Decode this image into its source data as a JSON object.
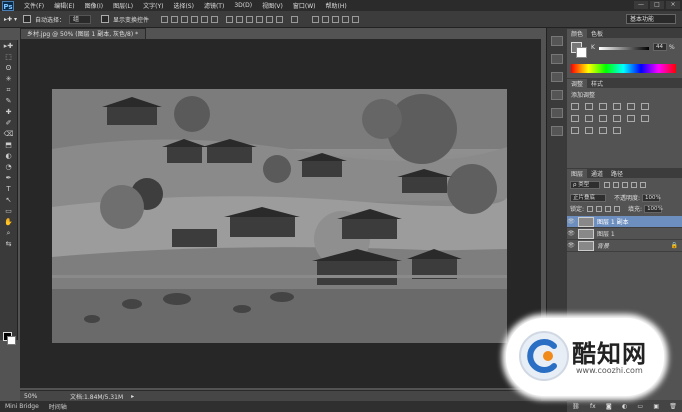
{
  "app": {
    "logo": "Ps"
  },
  "menu": [
    "文件(F)",
    "编辑(E)",
    "图像(I)",
    "图层(L)",
    "文字(Y)",
    "选择(S)",
    "滤镜(T)",
    "3D(D)",
    "视图(V)",
    "窗口(W)",
    "帮助(H)"
  ],
  "window_controls": [
    "—",
    "□",
    "×"
  ],
  "options": {
    "auto_select_label": "自动选择：",
    "auto_select_value": "组",
    "show_transform_label": "显示变换控件",
    "workspace": "基本功能"
  },
  "document": {
    "tab_title": "乡村.jpg @ 50% (图层 1 副本, 灰色/8) *",
    "tab_close": "×",
    "zoom": "50%",
    "doc_info": "文档:1.84M/5.31M"
  },
  "bottom_tabs": [
    "Mini Bridge",
    "时间轴"
  ],
  "tools": [
    "▸✚",
    "⬚",
    "ʘ",
    "✳",
    "⌗",
    "✎",
    "✚",
    "✐",
    "⌫",
    "⬒",
    "◐",
    "◔",
    "✒",
    "T",
    "↖",
    "▭",
    "✋",
    "⌕",
    "⇆"
  ],
  "color_panel": {
    "tabs": [
      "颜色",
      "色板"
    ],
    "value_label": "K",
    "value": "44",
    "unit": "%"
  },
  "adjustments_panel": {
    "tabs": [
      "调整",
      "样式"
    ],
    "title": "添加调整"
  },
  "layers_panel": {
    "tabs": [
      "图层",
      "通道",
      "路径"
    ],
    "filter_label": "ρ 类型",
    "blend_mode": "正片叠底",
    "opacity_label": "不透明度:",
    "opacity": "100%",
    "lock_label": "锁定:",
    "fill_label": "填充:",
    "fill": "100%",
    "layers": [
      {
        "name": "图层 1 副本",
        "selected": true
      },
      {
        "name": "图层 1",
        "selected": false
      },
      {
        "name": "背景",
        "selected": false
      }
    ]
  },
  "watermark": {
    "title": "酷知网",
    "url": "www.coozhi.com"
  },
  "colors": {
    "accent_selected": "#6d8fbf",
    "canvas_bg": "#272727"
  }
}
